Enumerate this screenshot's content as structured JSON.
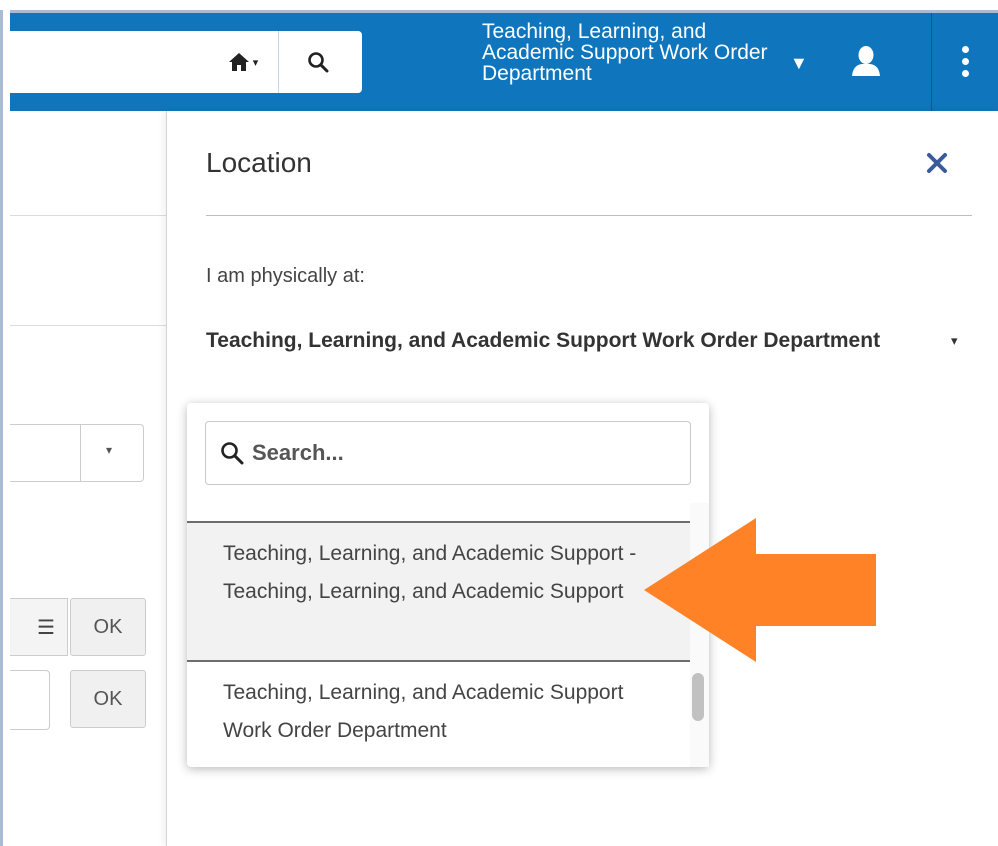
{
  "topbar": {
    "home_caret": "▾",
    "department_title": "Teaching, Learning, and Academic Support Work Order Department",
    "department_caret": "▼",
    "icons": [
      "home-icon",
      "search-icon",
      "user-icon",
      "more-vertical-icon"
    ]
  },
  "background_page": {
    "select_caret": "▾",
    "list_icon": "☰",
    "ok_label_1": "OK",
    "ok_label_2": "OK"
  },
  "location_panel": {
    "title": "Location",
    "close_icon": "close-icon",
    "label": "I am physically at:",
    "selected_value": "Teaching, Learning, and Academic Support Work Order Department",
    "select_caret": "▾",
    "dropdown": {
      "search_placeholder": "Search...",
      "options": [
        {
          "label": "Teaching, Learning, and Academic Support - Teaching, Learning, and Academic Support",
          "highlighted": true
        },
        {
          "label": "Teaching, Learning, and Academic Support Work Order Department",
          "highlighted": false
        }
      ]
    }
  },
  "colors": {
    "topbar_bg": "#0f75bc",
    "annotation_arrow": "#ff8227",
    "close_icon": "#3b5a9a"
  }
}
